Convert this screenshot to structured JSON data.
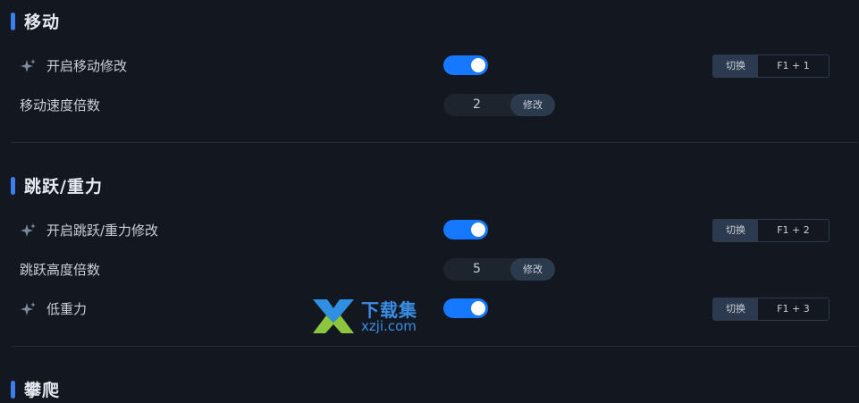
{
  "sections": [
    {
      "title": "移动",
      "rows": [
        {
          "label": "开启移动修改",
          "toggle_on": true,
          "hotkey_switch": "切换",
          "hotkey_keys": "F1 + 1"
        },
        {
          "label": "移动速度倍数",
          "value": "2",
          "button": "修改"
        }
      ]
    },
    {
      "title": "跳跃/重力",
      "rows": [
        {
          "label": "开启跳跃/重力修改",
          "toggle_on": true,
          "hotkey_switch": "切换",
          "hotkey_keys": "F1 + 2"
        },
        {
          "label": "跳跃高度倍数",
          "value": "5",
          "button": "修改"
        },
        {
          "label": "低重力",
          "toggle_on": true,
          "hotkey_switch": "切换",
          "hotkey_keys": "F1 + 3"
        }
      ]
    },
    {
      "title": "攀爬"
    }
  ],
  "watermark": {
    "title": "下载集",
    "url": "xzji.com"
  },
  "colors": {
    "accent": "#3d7df2",
    "toggle_on": "#1677ff",
    "background": "#121720"
  }
}
